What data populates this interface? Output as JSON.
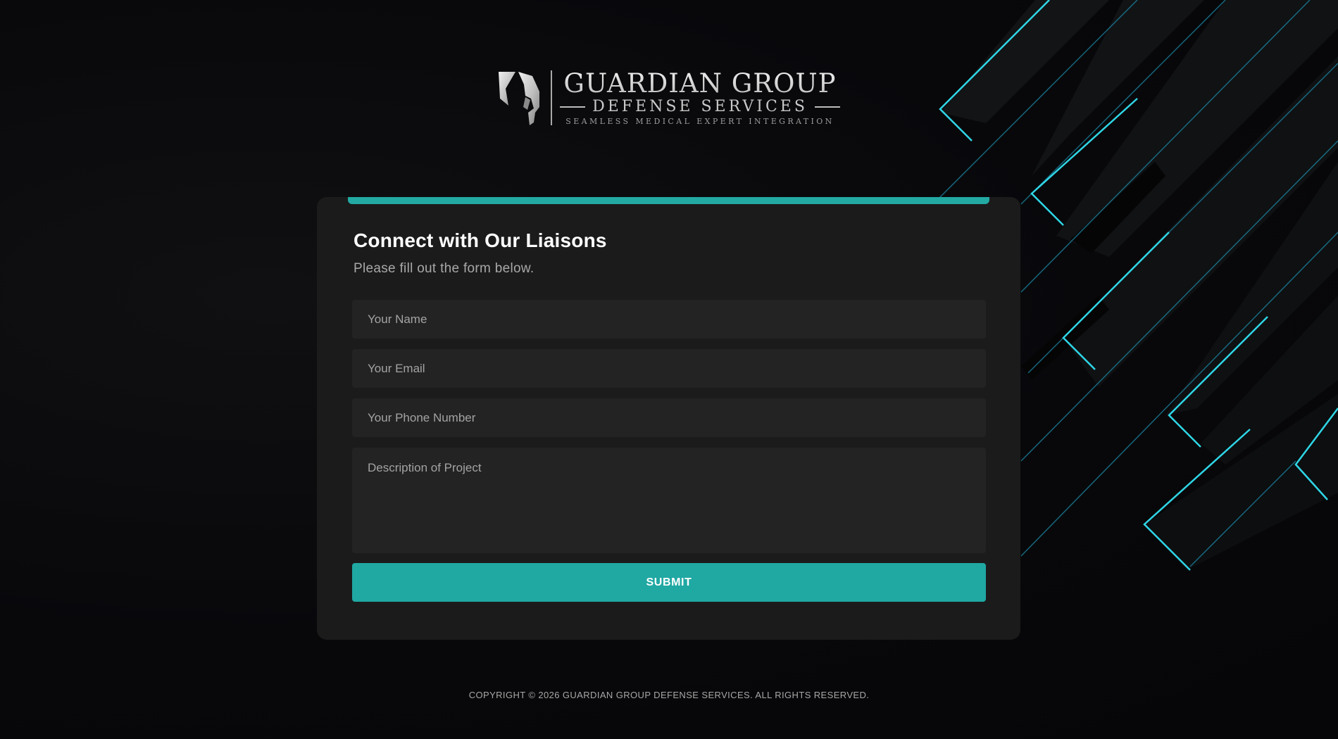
{
  "brand": {
    "name_line1": "GUARDIAN GROUP",
    "name_line2": "DEFENSE SERVICES",
    "tagline": "SEAMLESS MEDICAL EXPERT INTEGRATION",
    "logo_icon": "helmet-icon"
  },
  "form": {
    "title": "Connect with Our Liaisons",
    "subtitle": "Please fill out the form below.",
    "fields": {
      "name": {
        "placeholder": "Your Name",
        "value": ""
      },
      "email": {
        "placeholder": "Your Email",
        "value": ""
      },
      "phone": {
        "placeholder": "Your Phone Number",
        "value": ""
      },
      "description": {
        "placeholder": "Description of Project",
        "value": ""
      }
    },
    "submit_label": "SUBMIT"
  },
  "footer": {
    "copyright": "COPYRIGHT © 2026 GUARDIAN GROUP DEFENSE SERVICES. ALL RIGHTS RESERVED."
  },
  "colors": {
    "accent": "#20a8a3",
    "background": "#07070a",
    "card": "#1b1b1b",
    "field": "#232323",
    "glow": "#2fd6e6"
  }
}
